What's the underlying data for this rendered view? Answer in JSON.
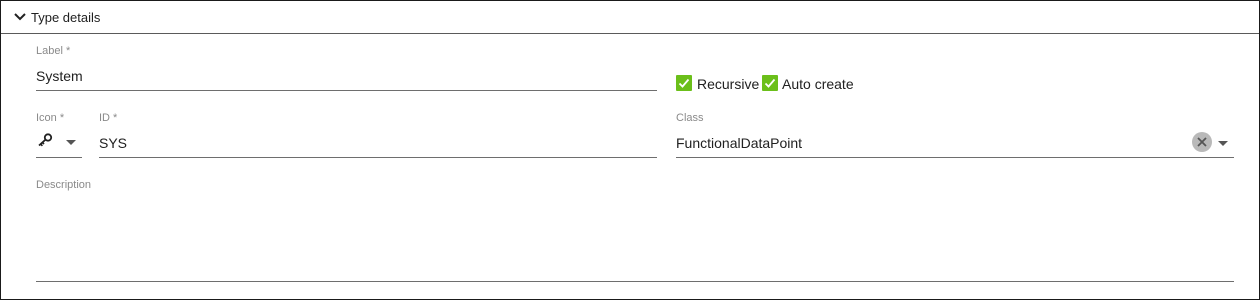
{
  "panel": {
    "title": "Type details",
    "expand_icon": "chevron-down-icon"
  },
  "fields": {
    "label": {
      "label": "Label *",
      "value": "System"
    },
    "icon": {
      "label": "Icon *",
      "selected_icon": "key-icon"
    },
    "id": {
      "label": "ID *",
      "value": "SYS"
    },
    "class": {
      "label": "Class",
      "value": "FunctionalDataPoint",
      "clear_icon": "clear-icon",
      "dropdown_icon": "caret-down-icon"
    },
    "description": {
      "label": "Description",
      "value": ""
    }
  },
  "checkboxes": [
    {
      "label": "Recursive",
      "checked": true
    },
    {
      "label": "Auto create",
      "checked": true
    }
  ],
  "colors": {
    "checkbox_accent": "#6bbf1a",
    "underline": "#6e6e6e",
    "field_label": "#8a8a8a"
  }
}
